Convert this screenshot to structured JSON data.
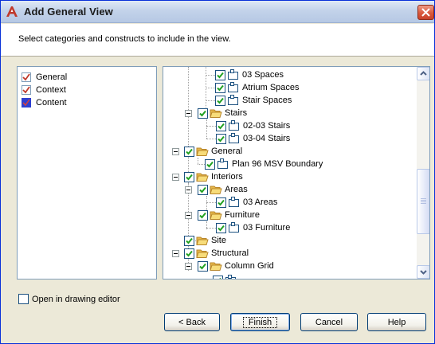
{
  "window": {
    "title": "Add General View",
    "app_icon": "autocad-a-icon",
    "close_icon": "close-icon"
  },
  "header": {
    "instruction": "Select categories and constructs to include in the view."
  },
  "categories": [
    {
      "label": "General",
      "icon": "checkmark-icon"
    },
    {
      "label": "Context",
      "icon": "checkmark-icon"
    },
    {
      "label": "Content",
      "icon": "content-blue-icon"
    }
  ],
  "tree": {
    "items": [
      {
        "label": "03 Spaces",
        "type": "view",
        "checked": true
      },
      {
        "label": "Atrium Spaces",
        "type": "view",
        "checked": true
      },
      {
        "label": "Stair Spaces",
        "type": "view",
        "checked": true
      },
      {
        "label": "Stairs",
        "type": "folder",
        "checked": true
      },
      {
        "label": "02-03 Stairs",
        "type": "view",
        "checked": true
      },
      {
        "label": "03-04 Stairs",
        "type": "view",
        "checked": true
      },
      {
        "label": "General",
        "type": "folder",
        "checked": true
      },
      {
        "label": "Plan 96 MSV Boundary",
        "type": "view",
        "checked": true
      },
      {
        "label": "Interiors",
        "type": "folder",
        "checked": true
      },
      {
        "label": "Areas",
        "type": "folder",
        "checked": true
      },
      {
        "label": "03 Areas",
        "type": "view",
        "checked": true
      },
      {
        "label": "Furniture",
        "type": "folder",
        "checked": true
      },
      {
        "label": "03 Furniture",
        "type": "view",
        "checked": true
      },
      {
        "label": "Site",
        "type": "folder",
        "checked": true
      },
      {
        "label": "Structural",
        "type": "folder",
        "checked": true
      },
      {
        "label": "Column Grid",
        "type": "folder",
        "checked": true
      }
    ]
  },
  "open_in_editor": {
    "label": "Open in drawing editor",
    "checked": false
  },
  "buttons": {
    "back": "< Back",
    "finish": "Finish",
    "cancel": "Cancel",
    "help": "Help"
  },
  "colors": {
    "accent": "#0831d9",
    "check": "#21a121",
    "folder": "#f5d36b",
    "close": "#d9593d"
  }
}
